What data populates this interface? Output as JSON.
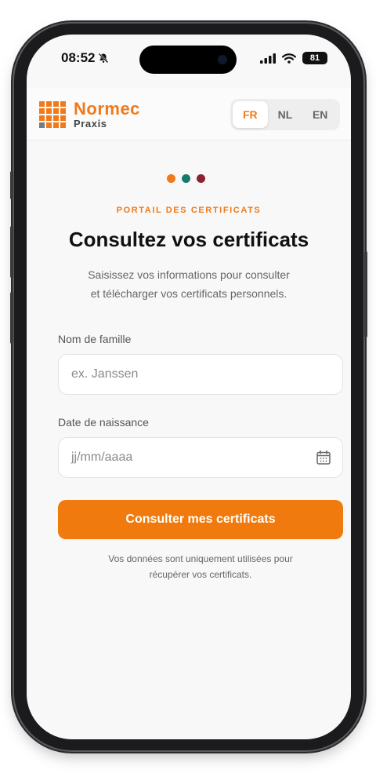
{
  "status_bar": {
    "time": "08:52",
    "battery": "81"
  },
  "header": {
    "brand": "Normec",
    "sub_brand": "Praxis",
    "languages": [
      {
        "code": "FR",
        "active": true
      },
      {
        "code": "NL",
        "active": false
      },
      {
        "code": "EN",
        "active": false
      }
    ]
  },
  "hero": {
    "dot_colors": [
      "#f07a1a",
      "#157a6e",
      "#8c2230"
    ],
    "eyebrow": "PORTAIL DES CERTIFICATS",
    "title": "Consultez vos certificats",
    "subtitle_line1": "Saisissez vos informations pour consulter",
    "subtitle_line2": "et télécharger vos certificats personnels."
  },
  "form": {
    "last_name_label": "Nom de famille",
    "last_name_placeholder": "ex. Janssen",
    "birth_date_label": "Date de naissance",
    "birth_date_placeholder": "jj/mm/aaaa",
    "submit_label": "Consulter mes certificats",
    "note_line1": "Vos données sont uniquement utilisées pour",
    "note_line2": "récupérer vos certificats."
  },
  "colors": {
    "accent": "#f07a0d",
    "text": "#111111",
    "muted": "#666666"
  }
}
